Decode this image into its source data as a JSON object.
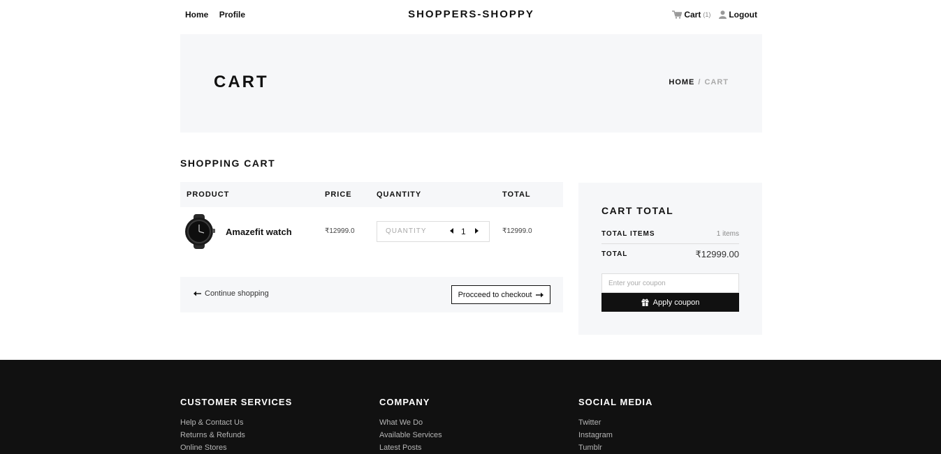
{
  "header": {
    "nav_left": [
      "Home",
      "Profile"
    ],
    "brand": "SHOPPERS-SHOPPY",
    "cart_label": "Cart",
    "cart_count": "(1)",
    "logout_label": "Logout"
  },
  "hero": {
    "title": "CART",
    "breadcrumb_home": "HOME",
    "breadcrumb_sep": "/",
    "breadcrumb_current": "CART"
  },
  "cart": {
    "section_title": "SHOPPING CART",
    "columns": [
      "PRODUCT",
      "PRICE",
      "QUANTITY",
      "TOTAL"
    ],
    "items": [
      {
        "name": "Amazefit watch",
        "price": "₹12999.0",
        "quantity_label": "QUANTITY",
        "quantity": "1",
        "total": "₹12999.0"
      }
    ],
    "continue_label": "Continue shopping",
    "checkout_label": "Procceed to checkout"
  },
  "summary": {
    "title": "CART TOTAL",
    "items_label": "TOTAL ITEMS",
    "items_value": "1 items",
    "total_label": "TOTAL",
    "total_value": "₹12999.00",
    "coupon_placeholder": "Enter your coupon",
    "coupon_button": "Apply coupon"
  },
  "footer": {
    "columns": [
      {
        "title": "CUSTOMER SERVICES",
        "links": [
          "Help & Contact Us",
          "Returns & Refunds",
          "Online Stores"
        ]
      },
      {
        "title": "COMPANY",
        "links": [
          "What We Do",
          "Available Services",
          "Latest Posts"
        ]
      },
      {
        "title": "SOCIAL MEDIA",
        "links": [
          "Twitter",
          "Instagram",
          "Tumblr"
        ]
      }
    ]
  },
  "icons": {
    "cart": "cart-icon",
    "user": "user-icon",
    "arrow_left": "arrow-left-icon",
    "arrow_right": "arrow-right-icon",
    "gift": "gift-icon"
  },
  "colors": {
    "accent": "#111111",
    "panel_bg": "#f6f7f9",
    "footer_bg": "#111111",
    "muted": "#aaaaaa"
  }
}
